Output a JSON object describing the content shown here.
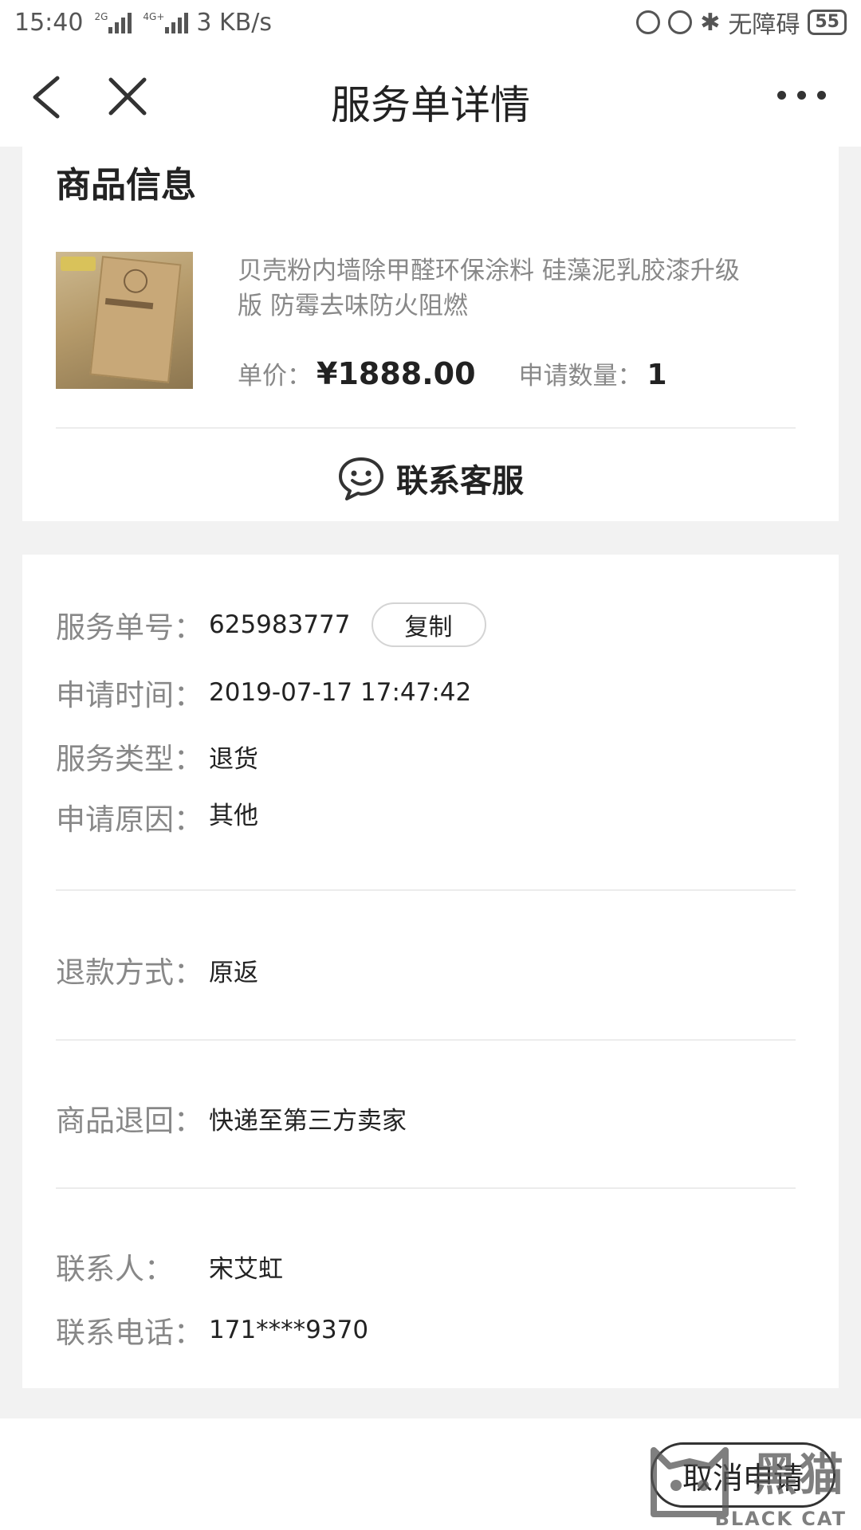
{
  "status_bar": {
    "time": "15:40",
    "net1": "2G",
    "net2": "4G+",
    "speed": "3 KB/s",
    "accessibility": "无障碍",
    "battery": "55"
  },
  "nav": {
    "title": "服务单详情"
  },
  "product": {
    "section_title": "商品信息",
    "name": "贝壳粉内墙除甲醛环保涂料 硅藻泥乳胶漆升级版 防霉去味防火阻燃",
    "price_label": "单价：",
    "price": "¥1888.00",
    "qty_label": "申请数量：",
    "qty": "1",
    "contact_service": "联系客服"
  },
  "details": {
    "service_no_label": "服务单号：",
    "service_no": "625983777",
    "copy_label": "复制",
    "apply_time_label": "申请时间：",
    "apply_time": "2019-07-17 17:47:42",
    "service_type_label": "服务类型：",
    "service_type": "退货",
    "reason_label": "申请原因：",
    "reason": "其他",
    "refund_method_label": "退款方式：",
    "refund_method": "原返",
    "return_label": "商品退回：",
    "return_method": "快递至第三方卖家",
    "contact_label": "联系人：",
    "contact": "宋艾虹",
    "phone_label": "联系电话：",
    "phone": "171****9370"
  },
  "footer": {
    "cancel_label": "取消申请",
    "watermark_cn": "黑猫",
    "watermark_en": "BLACK CAT"
  }
}
